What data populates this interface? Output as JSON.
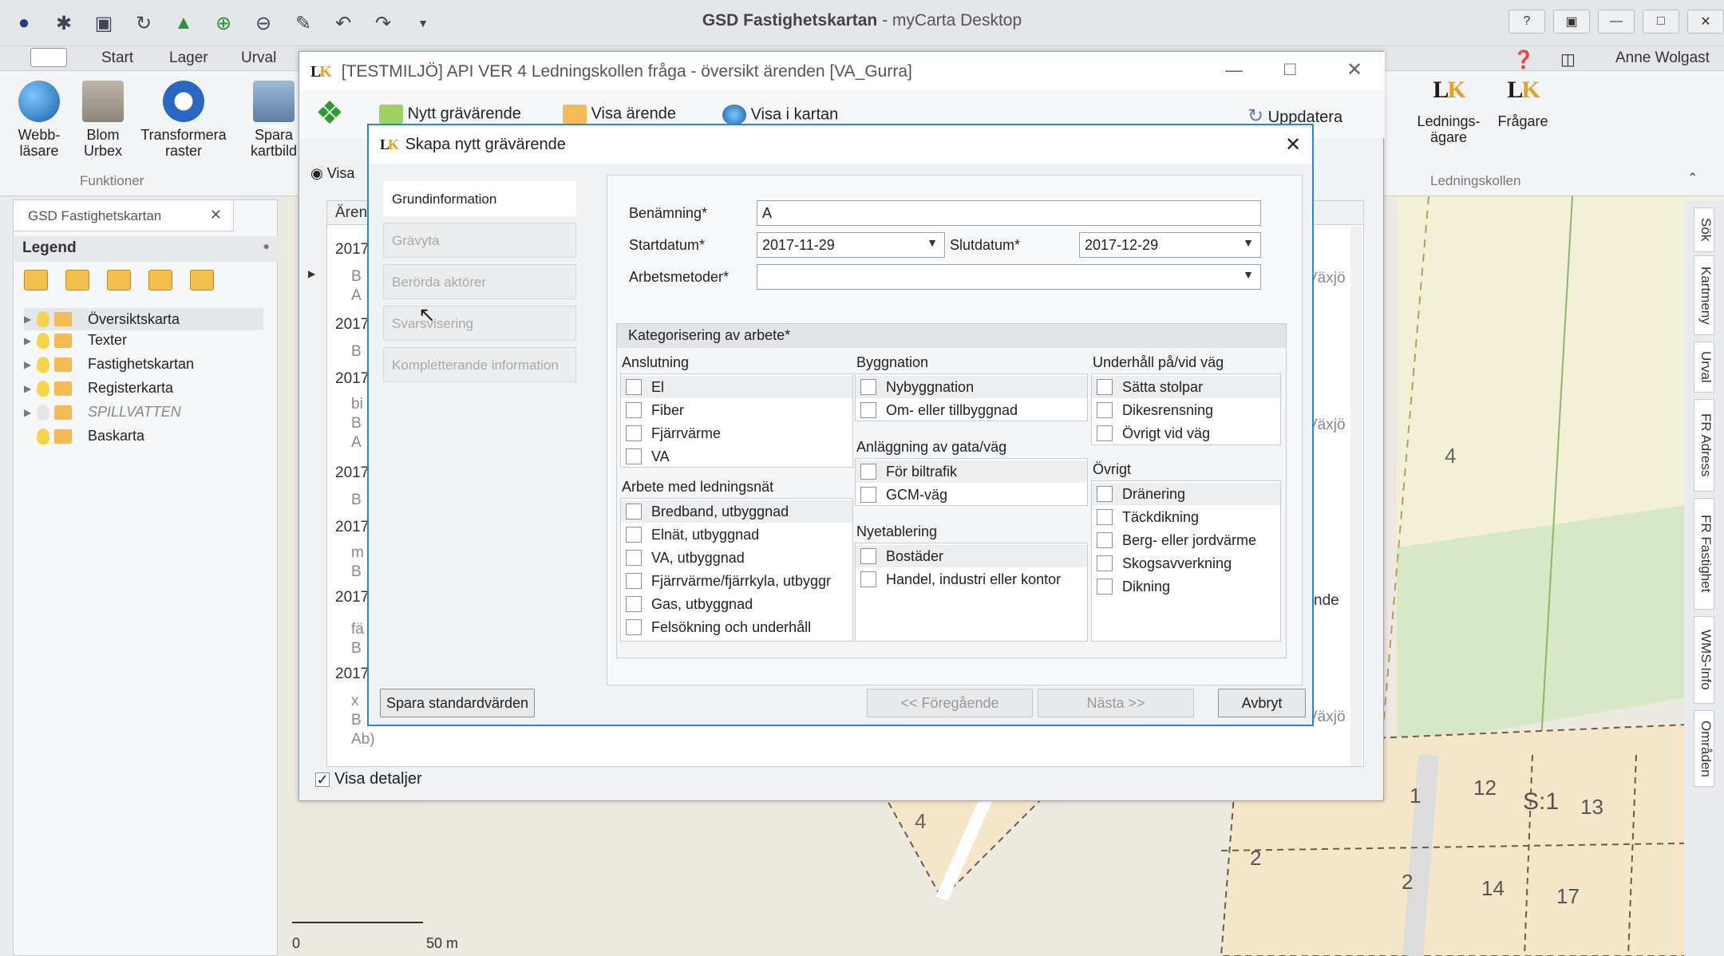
{
  "app": {
    "title_part1": "GSD Fastighetskartan",
    "title_part2": "- myCarta Desktop",
    "user": "Anne Wolgast"
  },
  "ribbon": {
    "tabs": [
      "Start",
      "Lager",
      "Urval"
    ],
    "buttons": {
      "webb_line1": "Webb-",
      "webb_line2": "läsare",
      "blom_line1": "Blom",
      "blom_line2": "Urbex",
      "transf_line1": "Transformera",
      "transf_line2": "raster",
      "spara_line1": "Spara",
      "spara_line2": "kartbild"
    },
    "group_funktioner": "Funktioner",
    "lk_owner_line1": "Lednings-",
    "lk_owner_line2": "ägare",
    "lk_asker": "Frågare",
    "group_lk": "Ledningskollen"
  },
  "left_panel": {
    "tab": "GSD Fastighetskartan",
    "legend_title": "Legend",
    "layers": [
      "Översiktskarta",
      "Texter",
      "Fastighetskartan",
      "Registerkarta",
      "SPILLVATTEN",
      "Baskarta"
    ]
  },
  "side_tabs": [
    "Sök",
    "Kartmeny",
    "Urval",
    "FR Adress",
    "FR Fastighet",
    "WMS-Info",
    "Områden"
  ],
  "map": {
    "scale_zero": "0",
    "scale_label": "50 m",
    "labels": [
      "4",
      "4",
      "1",
      "12",
      "S:1",
      "13",
      "2",
      "2",
      "14",
      "17"
    ]
  },
  "lk_window": {
    "title": "[TESTMILJÖ] API VER 4 Ledningskollen fråga - översikt ärenden [VA_Gurra]",
    "toolbar": {
      "new": "Nytt grävärende",
      "show": "Visa ärende",
      "map": "Visa i kartan",
      "update": "Uppdatera"
    },
    "filter_label": "Visa",
    "col_header": "Ärend",
    "years": [
      "2017",
      "2017",
      "2017",
      "2017",
      "2017",
      "2017",
      "2017"
    ],
    "cell_fragments": [
      "B",
      "A",
      "B",
      "bi",
      "B",
      "A",
      "B",
      "m",
      "B",
      "fä",
      "B",
      "x",
      "B",
      "Ab)"
    ],
    "right_col": [
      "Växjö",
      "Växjö",
      "nde",
      "Växjö"
    ],
    "visa_detaljer": "Visa detaljer"
  },
  "dialog": {
    "title": "Skapa nytt grävärende",
    "nav": [
      "Grundinformation",
      "Grävyta",
      "Berörda aktörer",
      "Svarsvisering",
      "Kompletterande information"
    ],
    "fields": {
      "benamning_label": "Benämning*",
      "benamning_value": "A",
      "startdatum_label": "Startdatum*",
      "startdatum_value": "2017-11-29",
      "slutdatum_label": "Slutdatum*",
      "slutdatum_value": "2017-12-29",
      "arbetsmetoder_label": "Arbetsmetoder*",
      "arbetsmetoder_value": ""
    },
    "kat_title": "Kategorisering av arbete*",
    "col1": {
      "anslutning": "Anslutning",
      "anslutning_items": [
        "El",
        "Fiber",
        "Fjärrvärme",
        "VA"
      ],
      "ledningsnat": "Arbete med ledningsnät",
      "ledningsnat_items": [
        "Bredband, utbyggnad",
        "Elnät, utbyggnad",
        "VA, utbyggnad",
        "Fjärrvärme/fjärrkyla, utbyggr",
        "Gas, utbyggnad",
        "Felsökning och underhåll"
      ]
    },
    "col2": {
      "byggnation": "Byggnation",
      "byggnation_items": [
        "Nybyggnation",
        "Om- eller tillbyggnad"
      ],
      "anlaggning": "Anläggning av gata/väg",
      "anlaggning_items": [
        "För biltrafik",
        "GCM-väg"
      ],
      "nyetablering": "Nyetablering",
      "nyetablering_items": [
        "Bostäder",
        "Handel, industri eller kontor"
      ]
    },
    "col3": {
      "underhall": "Underhåll på/vid väg",
      "underhall_items": [
        "Sätta stolpar",
        "Dikesrensning",
        "Övrigt vid väg"
      ],
      "ovrigt": "Övrigt",
      "ovrigt_items": [
        "Dränering",
        "Täckdikning",
        "Berg- eller jordvärme",
        "Skogsavverkning",
        "Dikning"
      ]
    },
    "buttons": {
      "save_defaults": "Spara standardvärden",
      "prev": "<< Föregående",
      "next": "Nästa >>",
      "cancel": "Avbryt"
    }
  }
}
